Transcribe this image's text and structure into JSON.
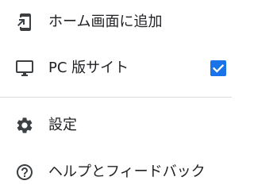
{
  "menu": {
    "items": [
      {
        "id": "add-home",
        "label": "ホーム画面に追加",
        "icon": "add-to-home-screen-icon"
      },
      {
        "id": "desktop-site",
        "label": "PC 版サイト",
        "icon": "desktop-computer-icon",
        "checked": true
      },
      {
        "id": "settings",
        "label": "設定",
        "icon": "gear-icon"
      },
      {
        "id": "help",
        "label": "ヘルプとフィードバック",
        "icon": "help-circle-icon"
      }
    ]
  },
  "colors": {
    "text": "#202124",
    "icon": "#3c4043",
    "accent": "#1a73e8",
    "divider": "#dadce0",
    "background": "#ffffff"
  }
}
